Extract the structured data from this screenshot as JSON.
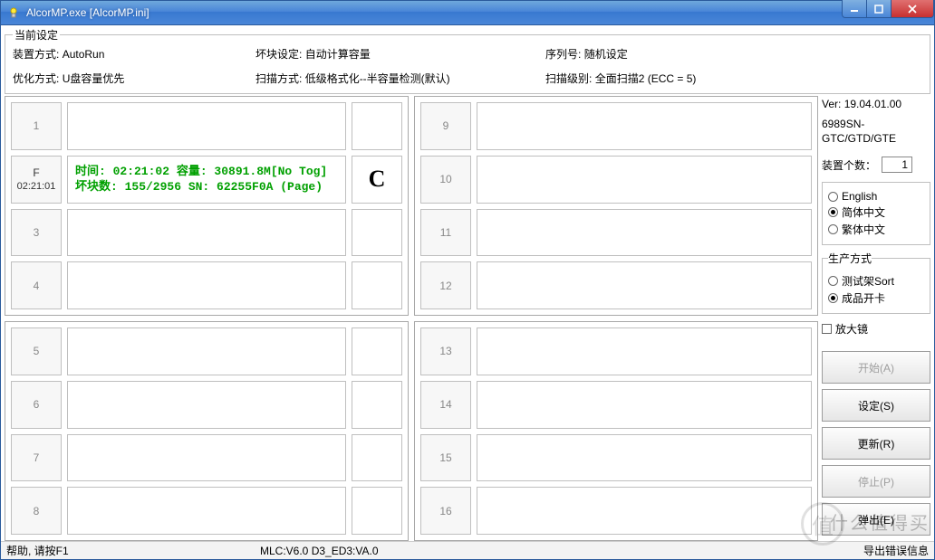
{
  "window": {
    "title": "AlcorMP.exe [AlcorMP.ini]"
  },
  "settings": {
    "legend": "当前设定",
    "r1c1_label": "装置方式:",
    "r1c1_value": "AutoRun",
    "r2c1_label": "优化方式:",
    "r2c1_value": "U盘容量优先",
    "r1c2_label": "坏块设定:",
    "r1c2_value": "自动计算容量",
    "r2c2_label": "扫描方式:",
    "r2c2_value": "低级格式化--半容量检测(默认)",
    "r1c3_label": "序列号:",
    "r1c3_value": "随机设定",
    "r2c3_label": "扫描级别:",
    "r2c3_value": "全面扫描2 (ECC = 5)"
  },
  "slots": {
    "labels": [
      "1",
      "F",
      "3",
      "4",
      "5",
      "6",
      "7",
      "8",
      "9",
      "10",
      "11",
      "12",
      "13",
      "14",
      "15",
      "16"
    ],
    "active_sub": "02:21:01",
    "active_line1": "时间: 02:21:02 容量: 30891.8M[No Tog]",
    "active_line2": "坏块数: 155/2956 SN: 62255F0A (Page)",
    "active_end": "C"
  },
  "side": {
    "ver_label": "Ver:",
    "ver_value": "19.04.01.00",
    "chip": "6989SN-GTC/GTD/GTE",
    "count_label": "装置个数：",
    "count_value": "1",
    "lang": {
      "en": "English",
      "sc": "简体中文",
      "tc": "繁体中文"
    },
    "mode": {
      "legend": "生产方式",
      "sort": "测试架Sort",
      "card": "成品开卡"
    },
    "magnifier": "放大镜",
    "buttons": {
      "start": "开始(A)",
      "setup": "设定(S)",
      "refresh": "更新(R)",
      "stop": "停止(P)",
      "eject": "弹出(E)"
    }
  },
  "status": {
    "left": "帮助, 请按F1",
    "mid": "MLC:V6.0    D3_ED3:VA.0",
    "right": "导出错误信息"
  },
  "watermark": {
    "text": "什么值得买",
    "circle": "值"
  }
}
